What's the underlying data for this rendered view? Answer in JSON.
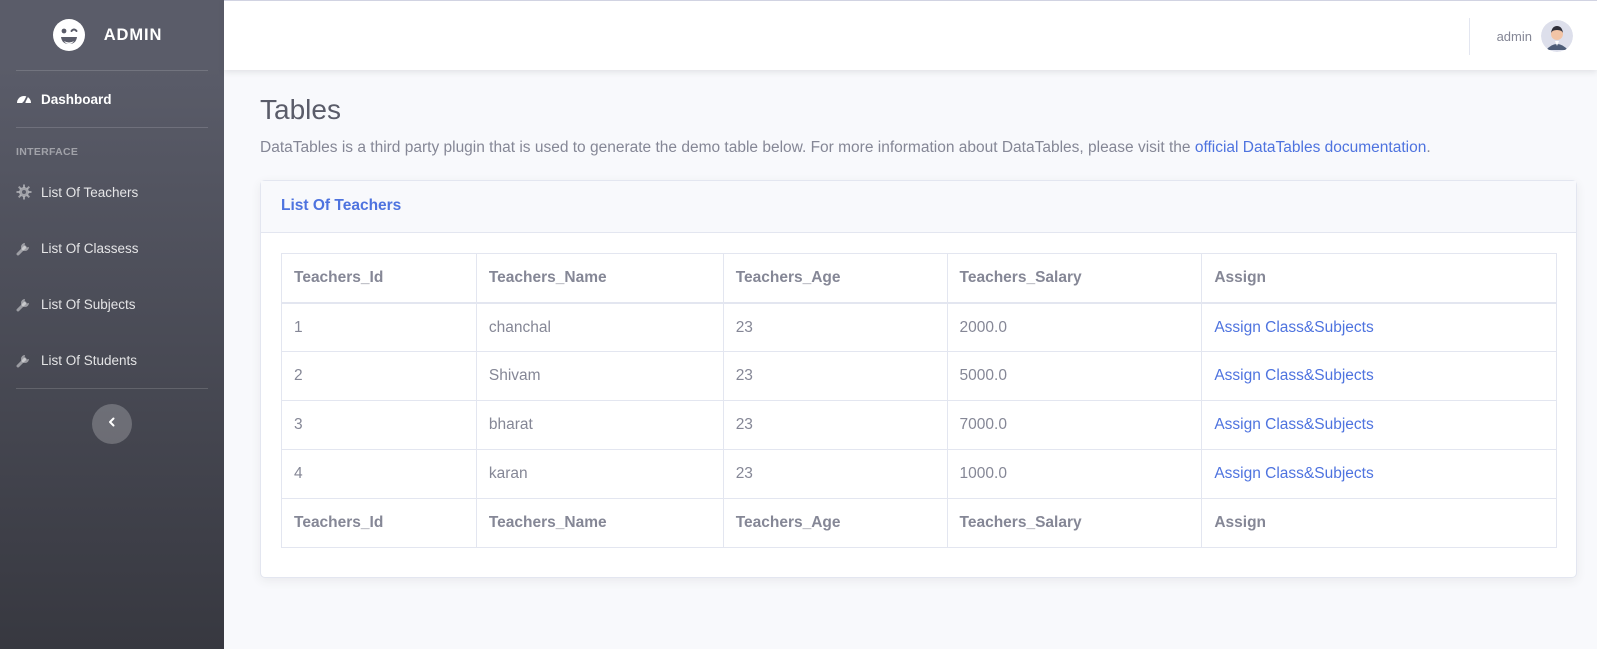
{
  "brand": {
    "name": "ADMIN",
    "logo_icon": "laugh-wink-icon"
  },
  "sidebar": {
    "dashboard": {
      "label": "Dashboard",
      "icon": "tachometer-icon"
    },
    "heading": "INTERFACE",
    "items": [
      {
        "label": "List Of Teachers",
        "icon": "cog-icon"
      },
      {
        "label": "List Of Classess",
        "icon": "wrench-icon"
      },
      {
        "label": "List Of Subjects",
        "icon": "wrench-icon"
      },
      {
        "label": "List Of Students",
        "icon": "wrench-icon"
      }
    ],
    "toggle_icon": "chevron-left-icon"
  },
  "topbar": {
    "username": "admin"
  },
  "page": {
    "title": "Tables",
    "intro_text": "DataTables is a third party plugin that is used to generate the demo table below. For more information about DataTables, please visit the ",
    "intro_link": "official DataTables documentation",
    "intro_end": "."
  },
  "card": {
    "title": "List Of Teachers",
    "columns": [
      "Teachers_Id",
      "Teachers_Name",
      "Teachers_Age",
      "Teachers_Salary",
      "Assign"
    ],
    "rows": [
      {
        "id": "1",
        "name": "chanchal",
        "age": "23",
        "salary": "2000.0",
        "assign": "Assign Class&Subjects"
      },
      {
        "id": "2",
        "name": "Shivam",
        "age": "23",
        "salary": "5000.0",
        "assign": "Assign Class&Subjects"
      },
      {
        "id": "3",
        "name": "bharat",
        "age": "23",
        "salary": "7000.0",
        "assign": "Assign Class&Subjects"
      },
      {
        "id": "4",
        "name": "karan",
        "age": "23",
        "salary": "1000.0",
        "assign": "Assign Class&Subjects"
      }
    ]
  },
  "colors": {
    "primary": "#4e73df",
    "sidebar_top": "#5a5c69",
    "sidebar_bottom": "#373840",
    "text": "#858796"
  }
}
